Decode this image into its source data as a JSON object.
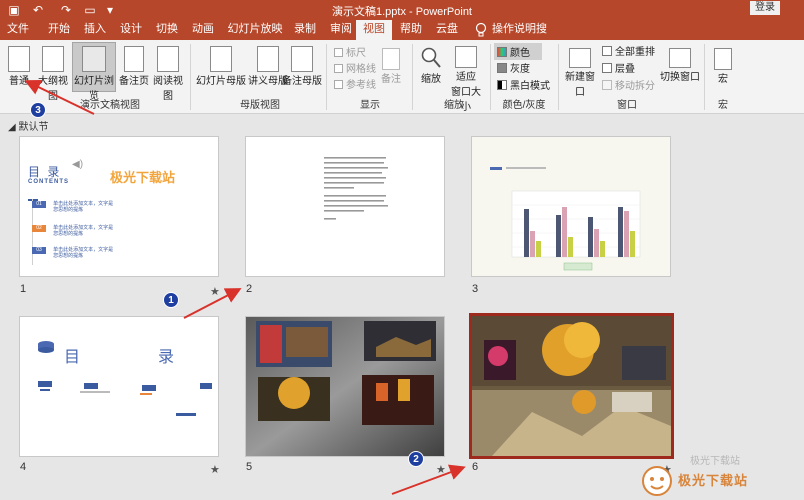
{
  "titlebar": {
    "title": "演示文稿1.pptx - PowerPoint",
    "login": "登录",
    "quick_access": [
      "save-icon",
      "undo-icon",
      "redo-icon",
      "present-icon",
      "customize-icon"
    ]
  },
  "tabs": [
    "文件",
    "开始",
    "插入",
    "设计",
    "切换",
    "动画",
    "幻灯片放映",
    "录制",
    "审阅",
    "视图",
    "帮助",
    "云盘",
    "操作说明搜索"
  ],
  "active_tab": "视图",
  "ribbon": {
    "views": {
      "buttons": [
        "普通",
        "大纲视图",
        "幻灯片浏览",
        "备注页",
        "阅读视图"
      ],
      "label": "演示文稿视图"
    },
    "master": {
      "buttons": [
        "幻灯片母版",
        "讲义母版",
        "备注母版"
      ],
      "label": "母版视图"
    },
    "show": {
      "checks": [
        "标尺",
        "网格线",
        "参考线"
      ],
      "notes": "备注",
      "label": "显示"
    },
    "zoom": {
      "zoom": "缩放",
      "fit_line1": "适应",
      "fit_line2": "窗口大小",
      "label": "缩放"
    },
    "color": {
      "items": [
        "颜色",
        "灰度",
        "黑白模式"
      ],
      "label": "颜色/灰度"
    },
    "window": {
      "new_window": "新建窗口",
      "items": [
        "全部重排",
        "层叠",
        "移动拆分"
      ],
      "label": "窗口"
    },
    "switch_window": "切换窗口",
    "macro": {
      "button": "宏",
      "label": "宏"
    }
  },
  "section_name": "默认节",
  "slides": [
    {
      "num": "1",
      "star": "★"
    },
    {
      "num": "2",
      "star": ""
    },
    {
      "num": "3",
      "star": ""
    },
    {
      "num": "4",
      "star": "★"
    },
    {
      "num": "5",
      "star": "★"
    },
    {
      "num": "6",
      "star": "★"
    }
  ],
  "slide1": {
    "title": "目 录",
    "subtitle": "CONTENTS",
    "brand": "极光下载站",
    "items": [
      {
        "tag": "01",
        "text_line1": "单击此处添加文本，文字是",
        "text_line2": "您思想的提炼"
      },
      {
        "tag": "02",
        "text_line1": "单击此处添加文本，文字是",
        "text_line2": "您思想的提炼"
      },
      {
        "tag": "03",
        "text_line1": "单击此处添加文本，文字是",
        "text_line2": "您思想的提炼"
      }
    ]
  },
  "slide4": {
    "left_char": "目",
    "right_char": "录"
  },
  "annotations": [
    "1",
    "2",
    "3"
  ],
  "watermark": {
    "main": "极光下载站",
    "sub": "极光下载站"
  }
}
